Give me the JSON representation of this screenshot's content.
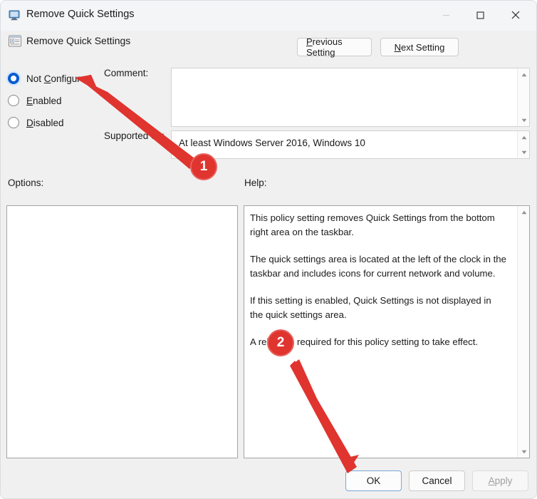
{
  "window": {
    "title": "Remove Quick Settings",
    "title_icon": "computer-monitor-icon",
    "minimize_label": "—",
    "maximize_label": "□",
    "close_label": "✕"
  },
  "header": {
    "policy_icon": "policy-setting-icon",
    "policy_name": "Remove Quick Settings",
    "previous_setting": {
      "accel": "P",
      "rest": "revious Setting"
    },
    "next_setting": {
      "accel": "N",
      "rest": "ext Setting"
    }
  },
  "state_options": {
    "selected": "Not Configured",
    "items": [
      {
        "name": "not-configured",
        "pre": "Not ",
        "accel": "C",
        "post": "onfigured",
        "selected": true
      },
      {
        "name": "enabled",
        "pre": "",
        "accel": "E",
        "post": "nabled",
        "selected": false
      },
      {
        "name": "disabled",
        "pre": "",
        "accel": "D",
        "post": "isabled",
        "selected": false
      }
    ]
  },
  "comment": {
    "label": "Comment:",
    "value": "",
    "placeholder": ""
  },
  "supported_on": {
    "label": "Supported on:",
    "value": "At least Windows Server 2016, Windows 10"
  },
  "panels": {
    "options_label": "Options:",
    "options_content": "",
    "help_label": "Help:",
    "help_paragraphs": [
      "This policy setting removes Quick Settings from the bottom right area on the taskbar.",
      "The quick settings area is located at the left of the clock in the taskbar and includes icons for current network and volume.",
      "If this setting is enabled, Quick Settings is not displayed in the quick settings area.",
      "A reboot is required for this policy setting to take effect."
    ]
  },
  "footer": {
    "ok_label": "OK",
    "cancel_label": "Cancel",
    "apply": {
      "accel": "A",
      "rest": "pply",
      "disabled": true
    }
  },
  "annotations": {
    "accent_color": "#e0342f",
    "markers": [
      {
        "number": "1",
        "points_to": "not-configured-radio"
      },
      {
        "number": "2",
        "points_to": "ok-button"
      }
    ]
  },
  "colors": {
    "dialog_background": "#f0f0f0",
    "titlebar_background": "#f3f5f7",
    "radio_selected": "#0a5bd3",
    "focus_border": "#7aa7d6",
    "annotation_red": "#e0342f"
  }
}
